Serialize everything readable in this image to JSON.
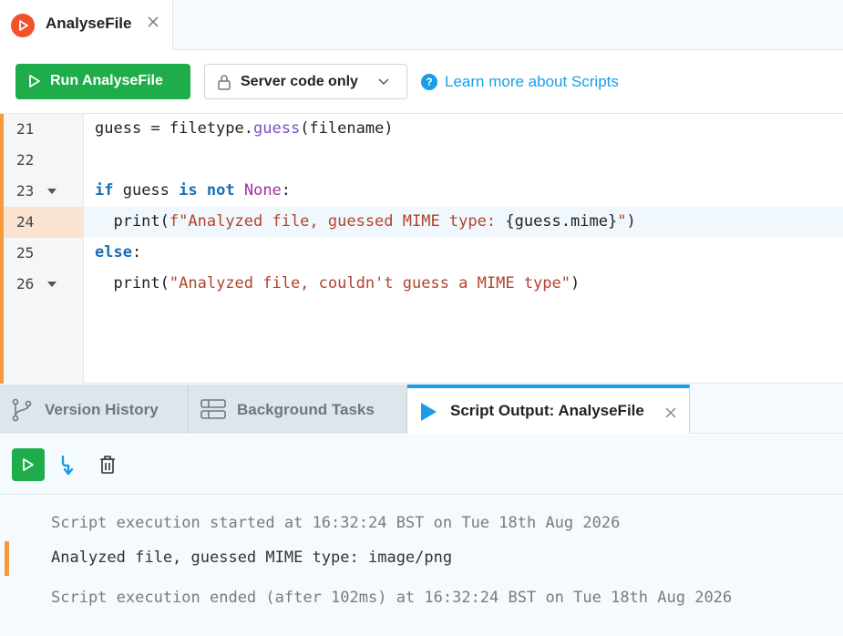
{
  "file_tab": {
    "title": "AnalyseFile",
    "icon": "play-circle-icon",
    "accent": "#f0522c"
  },
  "toolbar": {
    "run_label": "Run AnalyseFile",
    "mode_label": "Server code only",
    "learn_label": "Learn more about Scripts",
    "run_color": "#1fac4a",
    "link_color": "#1a9ce8"
  },
  "editor": {
    "lines": [
      {
        "num": "21",
        "code": "guess = filetype.guess(filename)"
      },
      {
        "num": "22",
        "code": ""
      },
      {
        "num": "23",
        "code": "if guess is not None:"
      },
      {
        "num": "24",
        "code": "  print(f\"Analyzed file, guessed MIME type: {guess.mime}\")"
      },
      {
        "num": "25",
        "code": "else:"
      },
      {
        "num": "26",
        "code": "  print(\"Analyzed file, couldn't guess a MIME type\")"
      }
    ],
    "active_line": "24"
  },
  "bottom_tabs": [
    {
      "label": "Version History",
      "icon": "git-branch-icon"
    },
    {
      "label": "Background Tasks",
      "icon": "server-icon"
    },
    {
      "label": "Script Output: AnalyseFile",
      "icon": "play-triangle-icon",
      "active": true
    }
  ],
  "console": {
    "lines": [
      "Script execution started at 16:32:24 BST on Tue 18th Aug 2026",
      "Analyzed file, guessed MIME type: image/png",
      "Script execution ended (after 102ms) at 16:32:24 BST on Tue 18th Aug 2026"
    ]
  }
}
